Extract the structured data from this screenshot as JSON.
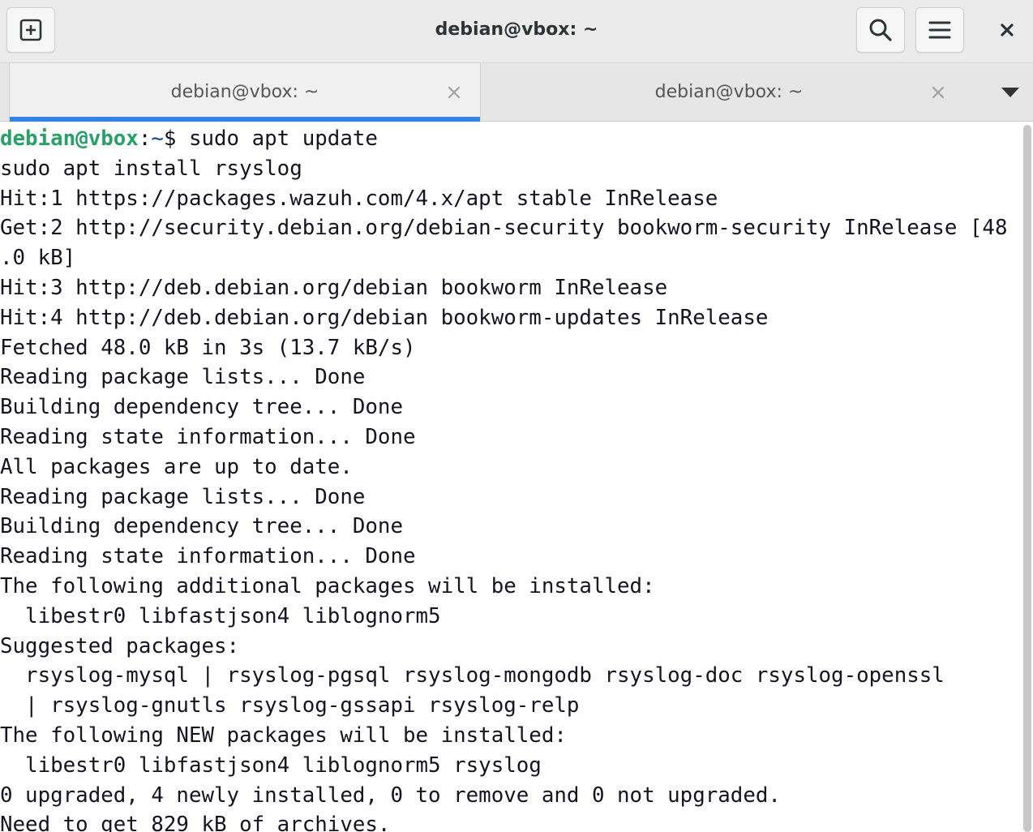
{
  "window": {
    "title": "debian@vbox: ~"
  },
  "headerbar": {
    "new_tab_icon": "plus-square-icon",
    "search_icon": "search-icon",
    "menu_icon": "hamburger-menu-icon",
    "close_icon": "close-icon"
  },
  "tabs": [
    {
      "label": "debian@vbox: ~",
      "active": true
    },
    {
      "label": "debian@vbox: ~",
      "active": false
    }
  ],
  "colors": {
    "accent": "#3584e4",
    "prompt_user": "#26a269",
    "prompt_path": "#12488b",
    "text": "#171421"
  },
  "terminal": {
    "prompt": {
      "user_host": "debian@vbox",
      "separator": ":",
      "path": "~",
      "symbol": "$",
      "command": " sudo apt update"
    },
    "lines": [
      "sudo apt install rsyslog",
      "Hit:1 https://packages.wazuh.com/4.x/apt stable InRelease",
      "Get:2 http://security.debian.org/debian-security bookworm-security InRelease [48",
      ".0 kB]",
      "Hit:3 http://deb.debian.org/debian bookworm InRelease",
      "Hit:4 http://deb.debian.org/debian bookworm-updates InRelease",
      "Fetched 48.0 kB in 3s (13.7 kB/s)",
      "Reading package lists... Done",
      "Building dependency tree... Done",
      "Reading state information... Done",
      "All packages are up to date.",
      "Reading package lists... Done",
      "Building dependency tree... Done",
      "Reading state information... Done",
      "The following additional packages will be installed:",
      "  libestr0 libfastjson4 liblognorm5",
      "Suggested packages:",
      "  rsyslog-mysql | rsyslog-pgsql rsyslog-mongodb rsyslog-doc rsyslog-openssl",
      "  | rsyslog-gnutls rsyslog-gssapi rsyslog-relp",
      "The following NEW packages will be installed:",
      "  libestr0 libfastjson4 liblognorm5 rsyslog",
      "0 upgraded, 4 newly installed, 0 to remove and 0 not upgraded.",
      "Need to get 829 kB of archives."
    ]
  }
}
